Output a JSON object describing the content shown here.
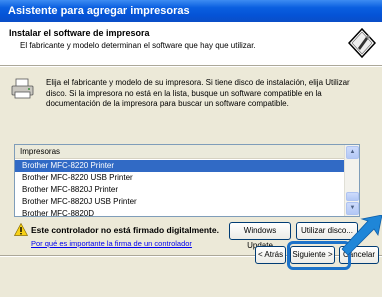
{
  "window": {
    "title": "Asistente para agregar impresoras"
  },
  "header": {
    "title": "Instalar el software de impresora",
    "subtitle": "El fabricante y modelo determinan el software que hay que utilizar."
  },
  "description": "Elija el fabricante y modelo de su impresora. Si tiene disco de instalación, elija Utilizar disco. Si la impresora no está en la lista, busque un software compatible en la documentación de la impresora para buscar un software compatible.",
  "printer_list": {
    "header": "Impresoras",
    "items": [
      {
        "label": "Brother MFC-8220 Printer",
        "selected": true
      },
      {
        "label": "Brother MFC-8220 USB Printer",
        "selected": false
      },
      {
        "label": "Brother MFC-8820J Printer",
        "selected": false
      },
      {
        "label": "Brother MFC-8820J USB Printer",
        "selected": false
      },
      {
        "label": "Brother MFC-8820D",
        "selected": false
      }
    ]
  },
  "warning": {
    "text": "Este controlador no está firmado digitalmente.",
    "link": "Por qué es importante la firma de un controlador"
  },
  "buttons": {
    "windows_update": "Windows Update",
    "have_disk": "Utilizar disco...",
    "back": "< Atrás",
    "next": "Siguiente >",
    "cancel": "Cancelar"
  },
  "colors": {
    "titlebar": "#0553d6",
    "selection": "#316ac5",
    "highlight": "#1c72c9",
    "dialog_bg": "#ece9d8"
  }
}
